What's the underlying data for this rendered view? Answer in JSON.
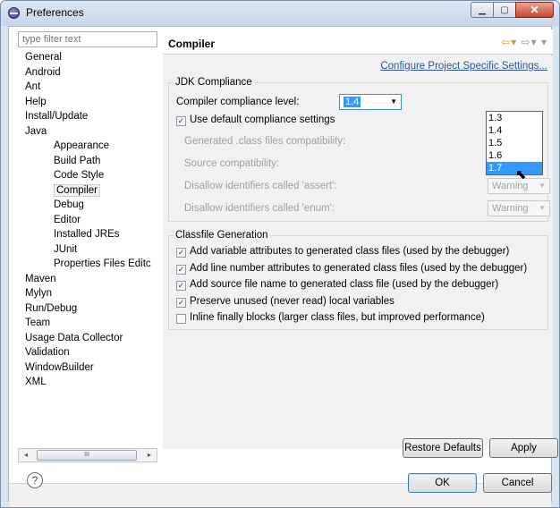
{
  "window": {
    "title": "Preferences"
  },
  "filter": {
    "placeholder": "type filter text"
  },
  "tree": {
    "items": [
      {
        "label": "General",
        "level": 0
      },
      {
        "label": "Android",
        "level": 0
      },
      {
        "label": "Ant",
        "level": 0
      },
      {
        "label": "Help",
        "level": 0
      },
      {
        "label": "Install/Update",
        "level": 0
      },
      {
        "label": "Java",
        "level": 0
      },
      {
        "label": "Appearance",
        "level": 1
      },
      {
        "label": "Build Path",
        "level": 1
      },
      {
        "label": "Code Style",
        "level": 1
      },
      {
        "label": "Compiler",
        "level": 1,
        "selected": true
      },
      {
        "label": "Debug",
        "level": 1
      },
      {
        "label": "Editor",
        "level": 1
      },
      {
        "label": "Installed JREs",
        "level": 1
      },
      {
        "label": "JUnit",
        "level": 1
      },
      {
        "label": "Properties Files Editc",
        "level": 1
      },
      {
        "label": "Maven",
        "level": 0
      },
      {
        "label": "Mylyn",
        "level": 0
      },
      {
        "label": "Run/Debug",
        "level": 0
      },
      {
        "label": "Team",
        "level": 0
      },
      {
        "label": "Usage Data Collector",
        "level": 0
      },
      {
        "label": "Validation",
        "level": 0
      },
      {
        "label": "WindowBuilder",
        "level": 0
      },
      {
        "label": "XML",
        "level": 0
      }
    ]
  },
  "page": {
    "title": "Compiler",
    "config_link": "Configure Project Specific Settings..."
  },
  "jdk": {
    "group_label": "JDK Compliance",
    "compliance_label": "Compiler compliance level:",
    "compliance_value": "1.4",
    "use_default_label": "Use default compliance settings",
    "use_default_checked": true,
    "generated_label": "Generated .class files compatibility:",
    "source_label": "Source compatibility:",
    "assert_label": "Disallow identifiers called 'assert':",
    "assert_value": "Warning",
    "enum_label": "Disallow identifiers called 'enum':",
    "enum_value": "Warning",
    "dropdown_options": [
      "1.3",
      "1.4",
      "1.5",
      "1.6",
      "1.7"
    ],
    "dropdown_highlighted": "1.7"
  },
  "classfile": {
    "group_label": "Classfile Generation",
    "options": [
      {
        "label": "Add variable attributes to generated class files (used by the debugger)",
        "checked": true
      },
      {
        "label": "Add line number attributes to generated class files (used by the debugger)",
        "checked": true
      },
      {
        "label": "Add source file name to generated class file (used by the debugger)",
        "checked": true
      },
      {
        "label": "Preserve unused (never read) local variables",
        "checked": true
      },
      {
        "label": "Inline finally blocks (larger class files, but improved performance)",
        "checked": false
      }
    ]
  },
  "buttons": {
    "restore_defaults": "Restore Defaults",
    "apply": "Apply",
    "ok": "OK",
    "cancel": "Cancel"
  },
  "icons": {
    "help": "?",
    "check": "✓",
    "dropdown_arrow": "▼",
    "nav_back": "⇦",
    "nav_forward": "⇨",
    "menu_arrow": "▾",
    "scroll_left": "◂",
    "scroll_right": "▸",
    "scroll_grip": "III",
    "cursor": "⬉"
  }
}
